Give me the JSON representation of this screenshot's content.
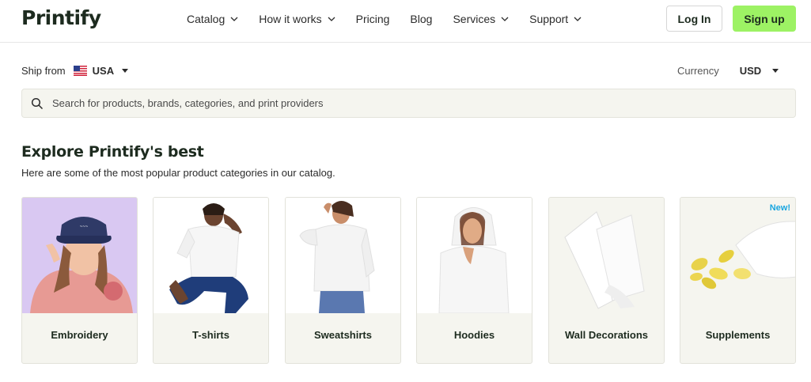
{
  "header": {
    "logo": "Printify",
    "nav": [
      {
        "label": "Catalog",
        "dropdown": true
      },
      {
        "label": "How it works",
        "dropdown": true
      },
      {
        "label": "Pricing",
        "dropdown": false
      },
      {
        "label": "Blog",
        "dropdown": false
      },
      {
        "label": "Services",
        "dropdown": true
      },
      {
        "label": "Support",
        "dropdown": true
      }
    ],
    "login_label": "Log In",
    "signup_label": "Sign up"
  },
  "ship": {
    "label": "Ship from",
    "value": "USA",
    "flag": "us-flag-icon"
  },
  "currency": {
    "label": "Currency",
    "value": "USD"
  },
  "search": {
    "placeholder": "Search for products, brands, categories, and print providers"
  },
  "section": {
    "title": "Explore Printify's best",
    "subtitle": "Here are some of the most popular product categories in our catalog."
  },
  "categories": [
    {
      "label": "Embroidery",
      "badge": ""
    },
    {
      "label": "T-shirts",
      "badge": ""
    },
    {
      "label": "Sweatshirts",
      "badge": ""
    },
    {
      "label": "Hoodies",
      "badge": ""
    },
    {
      "label": "Wall Decorations",
      "badge": ""
    },
    {
      "label": "Supplements",
      "badge": "New!"
    }
  ],
  "colors": {
    "accent": "#9df264",
    "card_bg": "#f5f5ef",
    "badge": "#1aa6e0"
  }
}
